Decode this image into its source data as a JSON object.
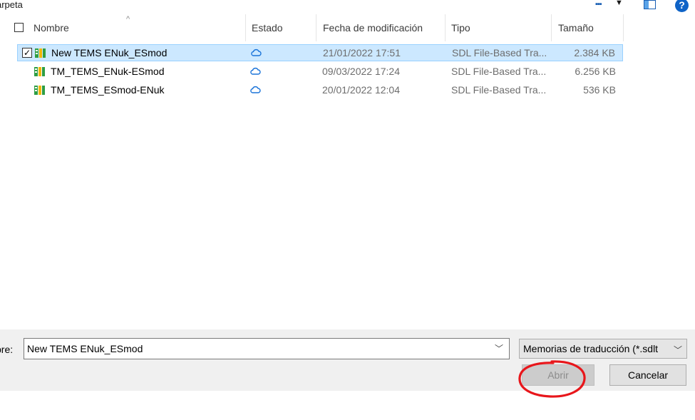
{
  "toolbar": {
    "title": "arpeta",
    "help_label": "?"
  },
  "columns": {
    "name": "Nombre",
    "status": "Estado",
    "modified": "Fecha de modificación",
    "type": "Tipo",
    "size": "Tamaño"
  },
  "files": [
    {
      "name": "New TEMS ENuk_ESmod",
      "date": "21/01/2022 17:51",
      "type": "SDL File-Based Tra...",
      "size": "2.384 KB",
      "selected": true
    },
    {
      "name": "TM_TEMS_ENuk-ESmod",
      "date": "09/03/2022 17:24",
      "type": "SDL File-Based Tra...",
      "size": "6.256 KB",
      "selected": false
    },
    {
      "name": "TM_TEMS_ESmod-ENuk",
      "date": "20/01/2022 12:04",
      "type": "SDL File-Based Tra...",
      "size": "536 KB",
      "selected": false
    }
  ],
  "footer": {
    "filename_label": "bre:",
    "filename_value": "New TEMS ENuk_ESmod",
    "filter_value": "Memorias de traducción (*.sdlt",
    "open_label": "Abrir",
    "cancel_label": "Cancelar"
  },
  "colors": {
    "selection": "#cce8ff",
    "annotation": "#e8161b",
    "cloud": "#1a73d9"
  },
  "icons": {
    "file": "sdl-tm-file-icon",
    "status": "cloud-icon"
  }
}
